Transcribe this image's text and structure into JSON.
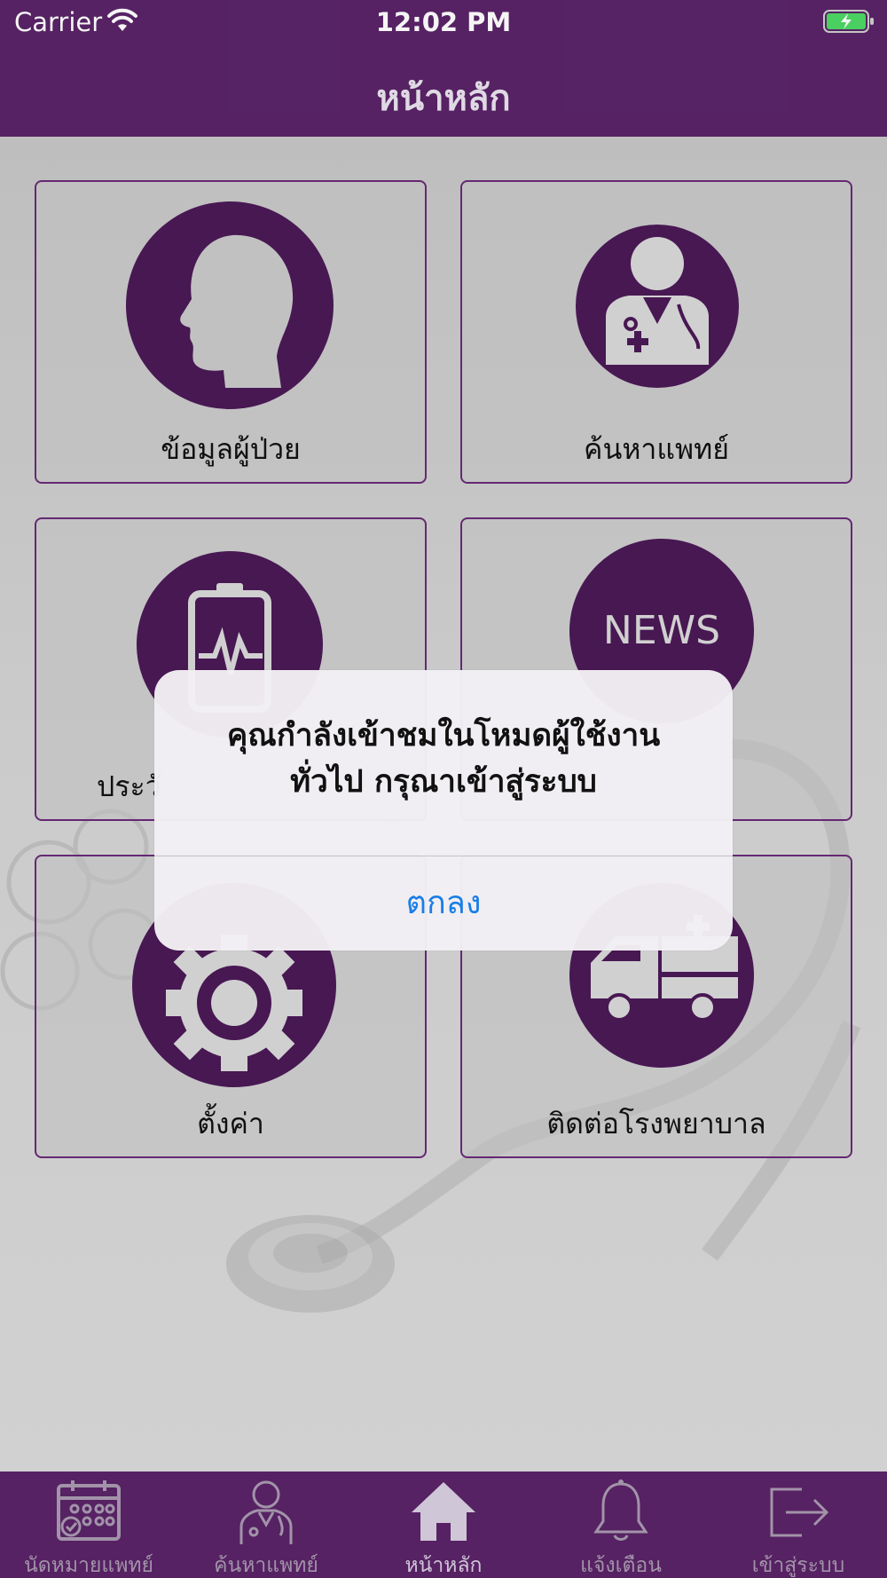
{
  "status_bar": {
    "carrier": "Carrier",
    "time": "12:02 PM"
  },
  "header": {
    "title": "หน้าหลัก"
  },
  "tiles": [
    {
      "label": "ข้อมูลผู้ป่วย",
      "icon": "patient-head-icon"
    },
    {
      "label": "ค้นหาแพทย์",
      "icon": "doctor-icon"
    },
    {
      "label": "ประวั",
      "icon": "health-monitor-icon"
    },
    {
      "label": "",
      "icon": "news-icon",
      "icon_text": "NEWS"
    },
    {
      "label": "ตั้งค่า",
      "icon": "gear-icon"
    },
    {
      "label": "ติดต่อโรงพยาบาล",
      "icon": "ambulance-icon"
    }
  ],
  "alert": {
    "message_line1": "คุณกำลังเข้าชมในโหมดผู้ใช้งาน",
    "message_line2": "ทั่วไป กรุณาเข้าสู่ระบบ",
    "ok_label": "ตกลง"
  },
  "tabbar": {
    "items": [
      {
        "label": "นัดหมายแพทย์",
        "icon": "calendar-icon"
      },
      {
        "label": "ค้นหาแพทย์",
        "icon": "doctor-icon"
      },
      {
        "label": "หน้าหลัก",
        "icon": "home-icon",
        "active": true
      },
      {
        "label": "แจ้งเตือน",
        "icon": "bell-icon"
      },
      {
        "label": "เข้าสู่ระบบ",
        "icon": "login-icon"
      }
    ]
  },
  "colors": {
    "brand_purple": "#5a2468",
    "icon_purple": "#4b1957",
    "alert_button_blue": "#1a7ee6"
  }
}
